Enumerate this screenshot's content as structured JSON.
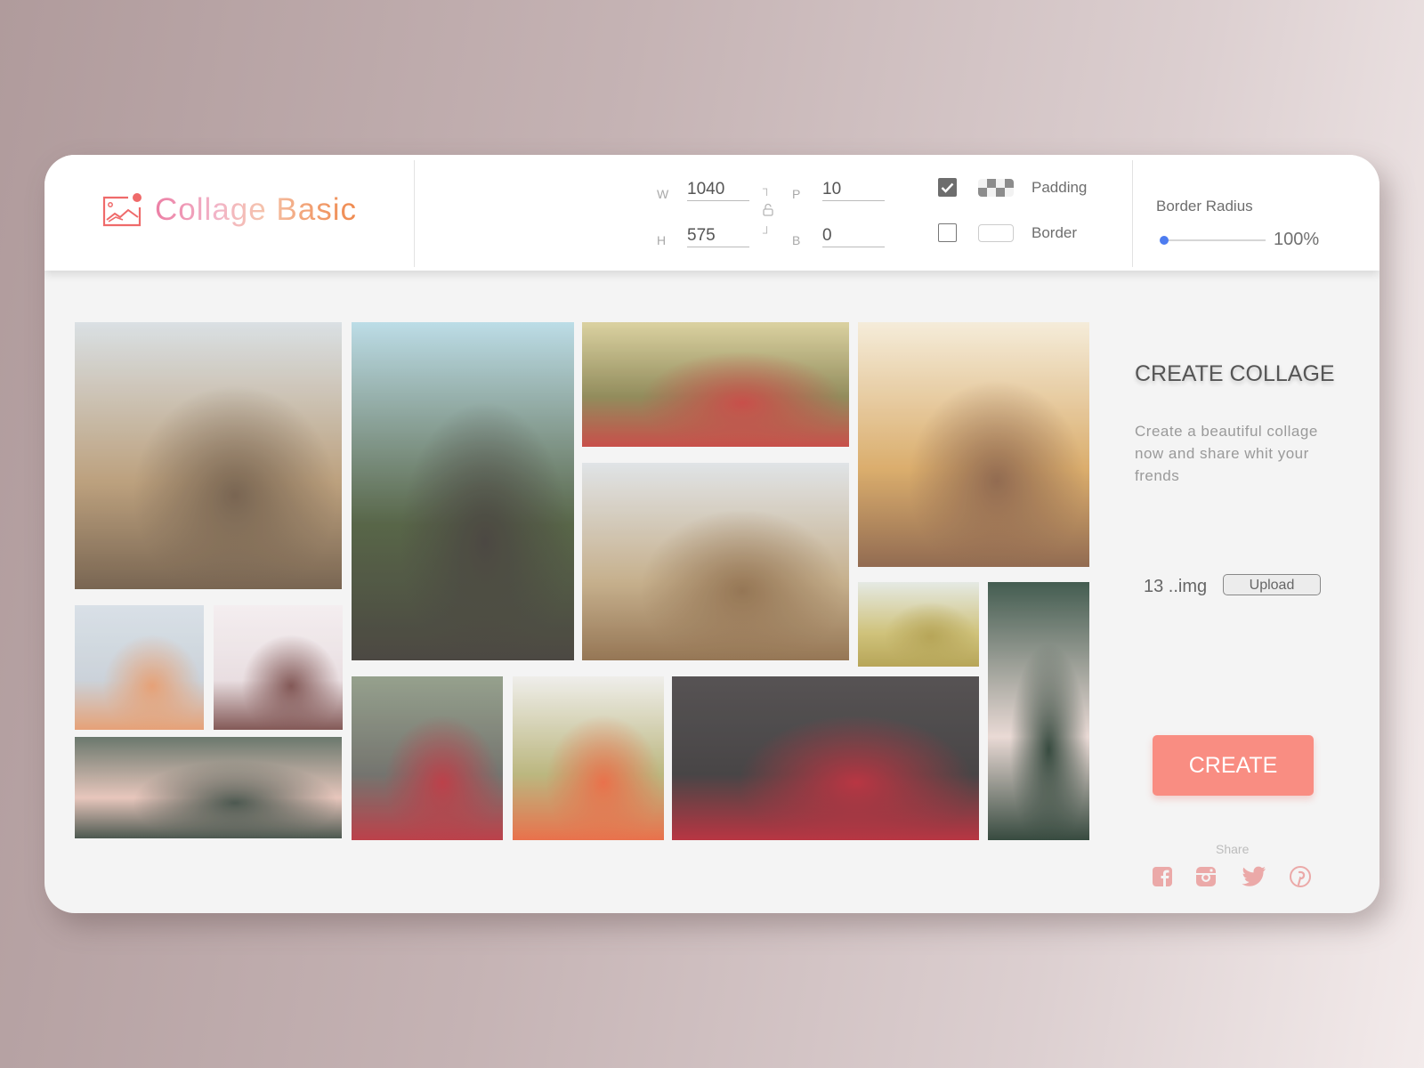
{
  "app": {
    "title": "Collage Basic",
    "logo_icon": "image-icon"
  },
  "dimensions": {
    "width_label": "W",
    "width_value": "1040",
    "height_label": "H",
    "height_value": "575",
    "padding_label": "P",
    "padding_value": "10",
    "border_label": "B",
    "border_value": "0",
    "lock_icon": "unlock-icon"
  },
  "options": [
    {
      "label": "Padding",
      "checked": true,
      "swatch": "checker-pattern"
    },
    {
      "label": "Border",
      "checked": false,
      "swatch": "plain"
    }
  ],
  "border_radius": {
    "label": "Border Radius",
    "value_text": "100%",
    "slider_fraction": 0.0,
    "accent": "#4d7cf0"
  },
  "collage": {
    "tiles": [
      {
        "name": "woman-in-dry-grass",
        "colors": [
          "#d8dfe3",
          "#b89a74",
          "#6f5a45"
        ]
      },
      {
        "name": "woman-by-river",
        "colors": [
          "#b8dbe6",
          "#4b5a3a",
          "#3e3a34"
        ]
      },
      {
        "name": "bird-with-berries",
        "colors": [
          "#d9cf9a",
          "#8a8450",
          "#c5423c"
        ]
      },
      {
        "name": "woman-in-sunlight",
        "colors": [
          "#f5ecd8",
          "#d9a862",
          "#8a6044"
        ]
      },
      {
        "name": "flowers-in-vase",
        "colors": [
          "#d7dfe6",
          "#c8d0d8",
          "#e59b6d"
        ]
      },
      {
        "name": "woman-sitting",
        "colors": [
          "#f4eef0",
          "#e9dde0",
          "#7a4c4a"
        ]
      },
      {
        "name": "wheat-field-path",
        "colors": [
          "#dfe3e6",
          "#c3ab85",
          "#8e6c48"
        ]
      },
      {
        "name": "tree-on-hill",
        "colors": [
          "#e4e9e3",
          "#cdbf72",
          "#b29f4c"
        ]
      },
      {
        "name": "hands-with-berries",
        "colors": [
          "#5f6e62",
          "#e7c3b8",
          "#3f4c43"
        ]
      },
      {
        "name": "hand-with-leaf",
        "colors": [
          "#355043",
          "#e9d8d3",
          "#283d31"
        ]
      },
      {
        "name": "knot-on-branch",
        "colors": [
          "#8e9a85",
          "#6a6a64",
          "#b8323c"
        ]
      },
      {
        "name": "poppy-field",
        "colors": [
          "#efeeea",
          "#b7b276",
          "#e8673e"
        ]
      },
      {
        "name": "red-dahlias",
        "colors": [
          "#4a4647",
          "#3a3738",
          "#b42634"
        ]
      }
    ]
  },
  "sidebar": {
    "title": "CREATE COLLAGE",
    "description": "Create a beautiful collage now and share whit your frends",
    "image_count": "13 ..img",
    "upload_label": "Upload",
    "create_label": "CREATE",
    "share_label": "Share",
    "social": [
      "facebook-icon",
      "instagram-icon",
      "twitter-icon",
      "pinterest-icon"
    ],
    "accent": "#f98d82"
  }
}
